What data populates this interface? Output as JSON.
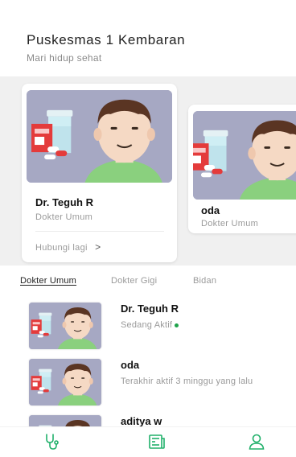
{
  "header": {
    "title": "Puskesmas 1 Kembaran",
    "subtitle": "Mari hidup sehat"
  },
  "featured": [
    {
      "name": "Dr. Teguh R",
      "role": "Dokter Umum",
      "contact_label": "Hubungi lagi",
      "chevron": ">"
    },
    {
      "name": "oda",
      "role": "Dokter Umum"
    }
  ],
  "tabs": [
    {
      "label": "Dokter Umum",
      "active": true
    },
    {
      "label": "Dokter Gigi",
      "active": false
    },
    {
      "label": "Bidan",
      "active": false
    }
  ],
  "doctors": [
    {
      "name": "Dr. Teguh R",
      "status": "Sedang Aktif",
      "online": true
    },
    {
      "name": "oda",
      "status": "Terakhir aktif 3 minggu yang lalu",
      "online": false
    },
    {
      "name": "aditya w",
      "status": "",
      "online": false
    }
  ],
  "nav": [
    {
      "icon": "stethoscope-icon"
    },
    {
      "icon": "news-icon"
    },
    {
      "icon": "profile-icon"
    }
  ],
  "colors": {
    "accent": "#20b06a",
    "avatar_bg": "#a6a8c3",
    "online_dot": "#1ea24a"
  }
}
